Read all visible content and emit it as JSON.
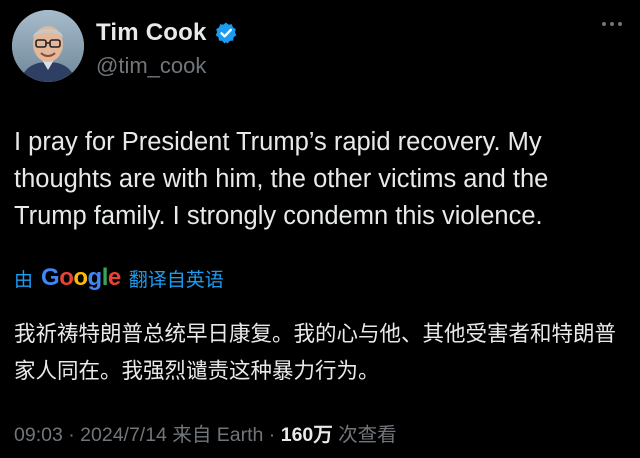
{
  "author": {
    "display_name": "Tim Cook",
    "handle": "@tim_cook"
  },
  "tweet": {
    "text": "I pray for President Trump’s rapid recovery.  My thoughts are with him, the other victims and the Trump family. I strongly condemn this violence."
  },
  "translation": {
    "by_label": "由",
    "google_letters": [
      "G",
      "o",
      "o",
      "g",
      "l",
      "e"
    ],
    "google_colors": [
      "#4285F4",
      "#EA4335",
      "#FBBC05",
      "#4285F4",
      "#34A853",
      "#EA4335"
    ],
    "translate_label": "翻译自英语",
    "text": "我祈祷特朗普总统早日康复。我的心与他、其他受害者和特朗普家人同在。我强烈谴责这种暴力行为。"
  },
  "meta": {
    "time": "09:03",
    "separator1": " · ",
    "date": "2024/7/14",
    "source": " 来自 Earth",
    "separator2": " · ",
    "views": "160万",
    "views_label": " 次查看"
  },
  "icons": {
    "verified": "verified-badge-icon",
    "more": "more-options-icon"
  },
  "colors": {
    "background": "#000000",
    "text_primary": "#e7e9ea",
    "text_secondary": "#71767b",
    "accent": "#1d9bf0"
  }
}
